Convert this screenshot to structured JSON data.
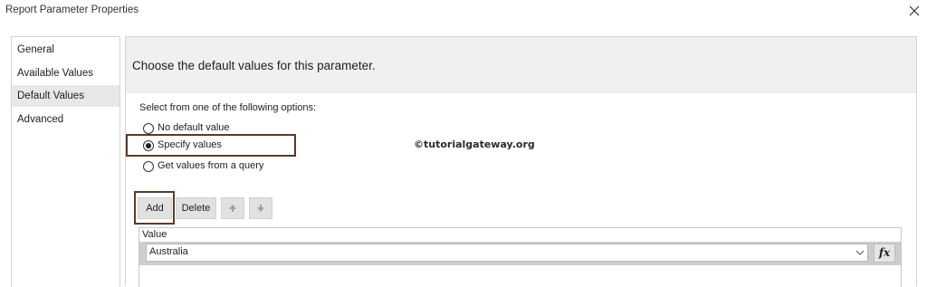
{
  "window": {
    "title": "Report Parameter Properties",
    "close_icon": "close-icon"
  },
  "nav": {
    "items": [
      {
        "label": "General",
        "selected": false
      },
      {
        "label": "Available Values",
        "selected": false
      },
      {
        "label": "Default Values",
        "selected": true
      },
      {
        "label": "Advanced",
        "selected": false
      }
    ]
  },
  "page": {
    "header": "Choose the default values for this parameter.",
    "prompt": "Select from one of the following options:",
    "options": [
      {
        "label": "No default value",
        "checked": false
      },
      {
        "label": "Specify values",
        "checked": true
      },
      {
        "label": "Get values from a query",
        "checked": false
      }
    ],
    "watermark": "©tutorialgateway.org",
    "buttons": {
      "add": "Add",
      "delete": "Delete",
      "move_up_icon": "arrow-up-icon",
      "move_down_icon": "arrow-down-icon"
    },
    "grid": {
      "column": "Value",
      "rows": [
        {
          "value": "Australia"
        }
      ],
      "expression_button": "fx"
    }
  },
  "colors": {
    "highlight": "#5b3a2e",
    "header_band": "#f0f0f0",
    "selected_nav": "#e8e8e8"
  }
}
